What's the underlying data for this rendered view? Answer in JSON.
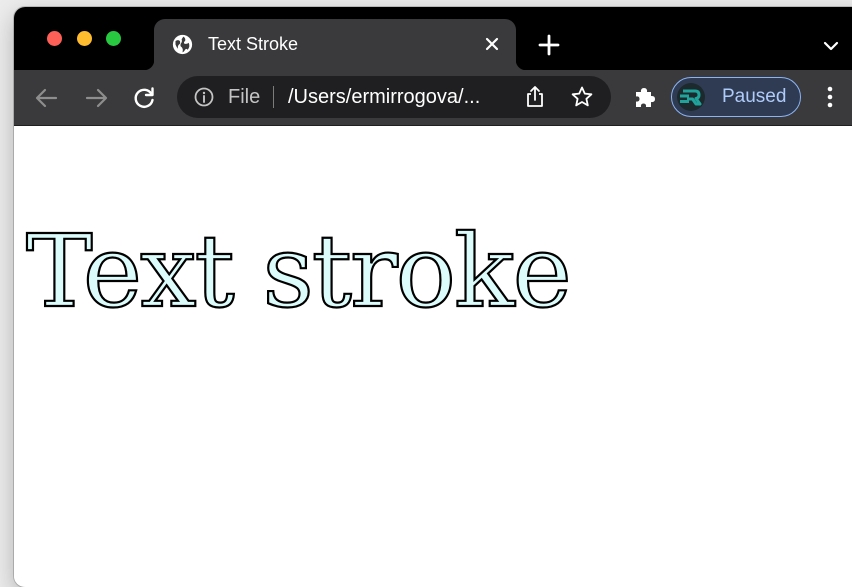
{
  "browser": {
    "tab": {
      "title": "Text Stroke",
      "favicon": "globe-icon"
    },
    "address_bar": {
      "scheme_label": "File",
      "url": "/Users/ermirrogova/..."
    },
    "profile": {
      "label": "Paused",
      "avatar": "rgg-logo"
    },
    "icons": {
      "back": "arrow-left-icon",
      "forward": "arrow-right-icon",
      "reload": "reload-icon",
      "info": "info-icon",
      "share": "share-icon",
      "bookmark": "star-icon",
      "extensions": "puzzle-icon",
      "menu": "kebab-menu-icon",
      "new_tab": "plus-icon",
      "tab_search": "chevron-down-icon"
    },
    "colors": {
      "tabstrip": "#000000",
      "toolbar": "#3a3a3c",
      "profile_accent": "#8ab4f8"
    }
  },
  "page": {
    "heading": "Text stroke",
    "heading_fill": "#dcfbfb",
    "heading_stroke": "#000000"
  }
}
